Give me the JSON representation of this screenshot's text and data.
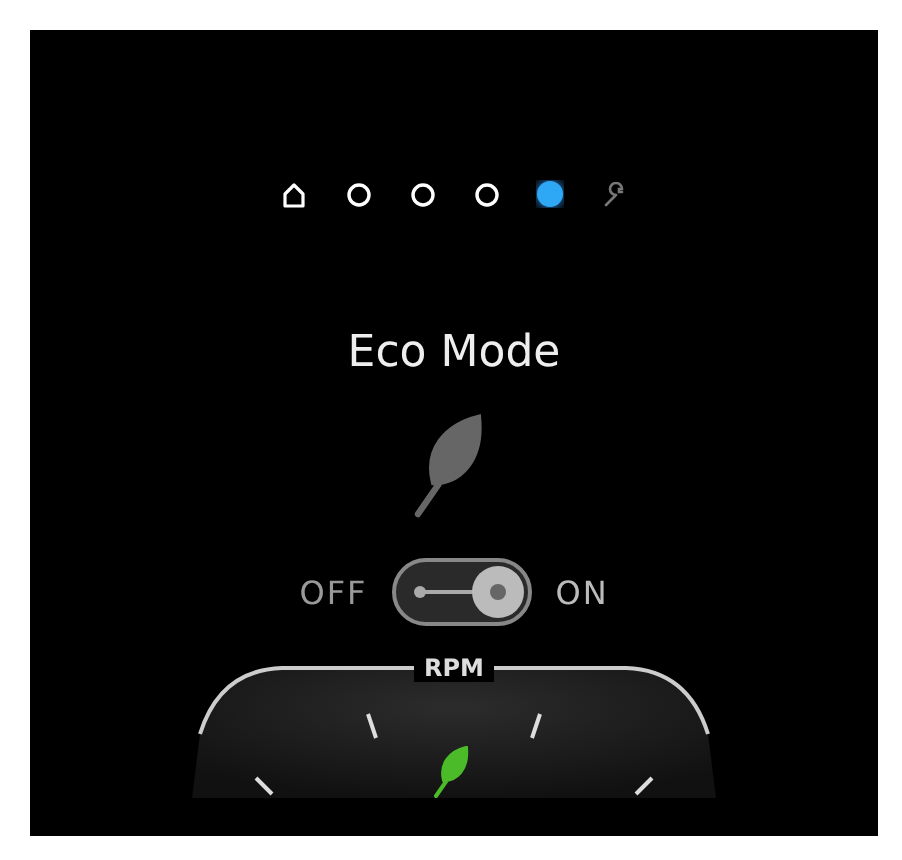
{
  "pager": [
    {
      "kind": "home",
      "selected": false
    },
    {
      "kind": "dot",
      "selected": false
    },
    {
      "kind": "dot",
      "selected": false
    },
    {
      "kind": "dot",
      "selected": false
    },
    {
      "kind": "dot",
      "selected": true
    },
    {
      "kind": "wrench",
      "selected": false
    }
  ],
  "title": "Eco Mode",
  "toggle": {
    "off_label": "OFF",
    "on_label": "ON",
    "on": true
  },
  "gauge": {
    "label": "RPM",
    "eco_active": true
  }
}
